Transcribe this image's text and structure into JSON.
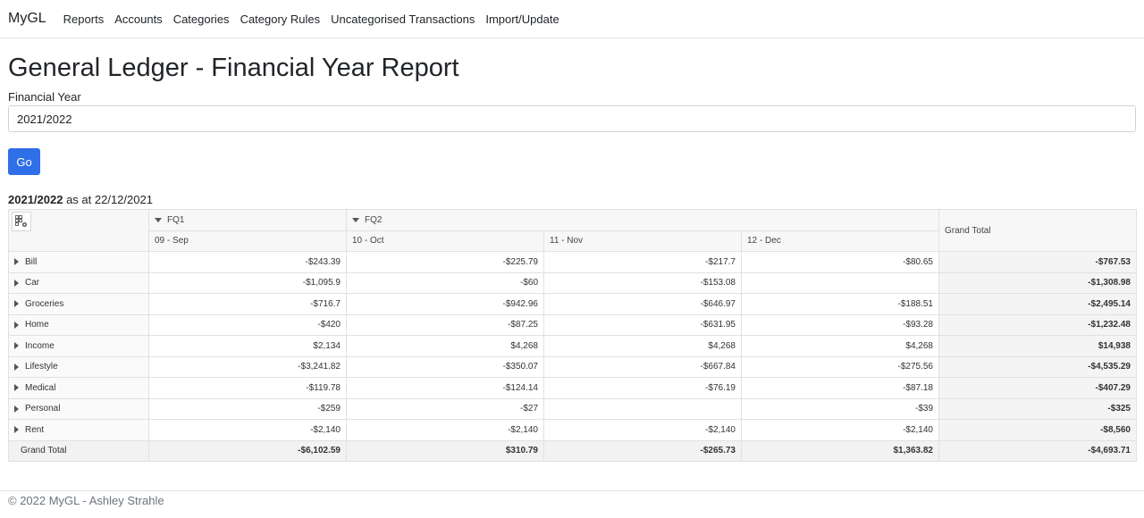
{
  "nav": {
    "brand": "MyGL",
    "links": [
      "Reports",
      "Accounts",
      "Categories",
      "Category Rules",
      "Uncategorised Transactions",
      "Import/Update"
    ]
  },
  "page": {
    "title": "General Ledger - Financial Year Report"
  },
  "form": {
    "label": "Financial Year",
    "value": "2021/2022",
    "button": "Go"
  },
  "report": {
    "year": "2021/2022",
    "as_at": "as at 22/12/2021",
    "quarters": [
      "FQ1",
      "FQ2"
    ],
    "months": [
      "09 - Sep",
      "10 - Oct",
      "11 - Nov",
      "12 - Dec"
    ],
    "grand_total_label": "Grand Total",
    "rows": [
      {
        "name": "Bill",
        "values": [
          "-$243.39",
          "-$225.79",
          "-$217.7",
          "-$80.65"
        ],
        "total": "-$767.53"
      },
      {
        "name": "Car",
        "values": [
          "-$1,095.9",
          "-$60",
          "-$153.08",
          ""
        ],
        "total": "-$1,308.98"
      },
      {
        "name": "Groceries",
        "values": [
          "-$716.7",
          "-$942.96",
          "-$646.97",
          "-$188.51"
        ],
        "total": "-$2,495.14"
      },
      {
        "name": "Home",
        "values": [
          "-$420",
          "-$87.25",
          "-$631.95",
          "-$93.28"
        ],
        "total": "-$1,232.48"
      },
      {
        "name": "Income",
        "values": [
          "$2,134",
          "$4,268",
          "$4,268",
          "$4,268"
        ],
        "total": "$14,938"
      },
      {
        "name": "Lifestyle",
        "values": [
          "-$3,241.82",
          "-$350.07",
          "-$667.84",
          "-$275.56"
        ],
        "total": "-$4,535.29"
      },
      {
        "name": "Medical",
        "values": [
          "-$119.78",
          "-$124.14",
          "-$76.19",
          "-$87.18"
        ],
        "total": "-$407.29"
      },
      {
        "name": "Personal",
        "values": [
          "-$259",
          "-$27",
          "",
          "-$39"
        ],
        "total": "-$325"
      },
      {
        "name": "Rent",
        "values": [
          "-$2,140",
          "-$2,140",
          "-$2,140",
          "-$2,140"
        ],
        "total": "-$8,560"
      }
    ],
    "grand_total_row": {
      "values": [
        "-$6,102.59",
        "$310.79",
        "-$265.73",
        "$1,363.82"
      ],
      "total": "-$4,693.71"
    }
  },
  "footer": {
    "text": "© 2022 MyGL - Ashley Strahle"
  },
  "icons": {
    "field-list": "grid-settings-icon",
    "expand": "triangle-right-icon",
    "collapse": "triangle-down-icon"
  }
}
